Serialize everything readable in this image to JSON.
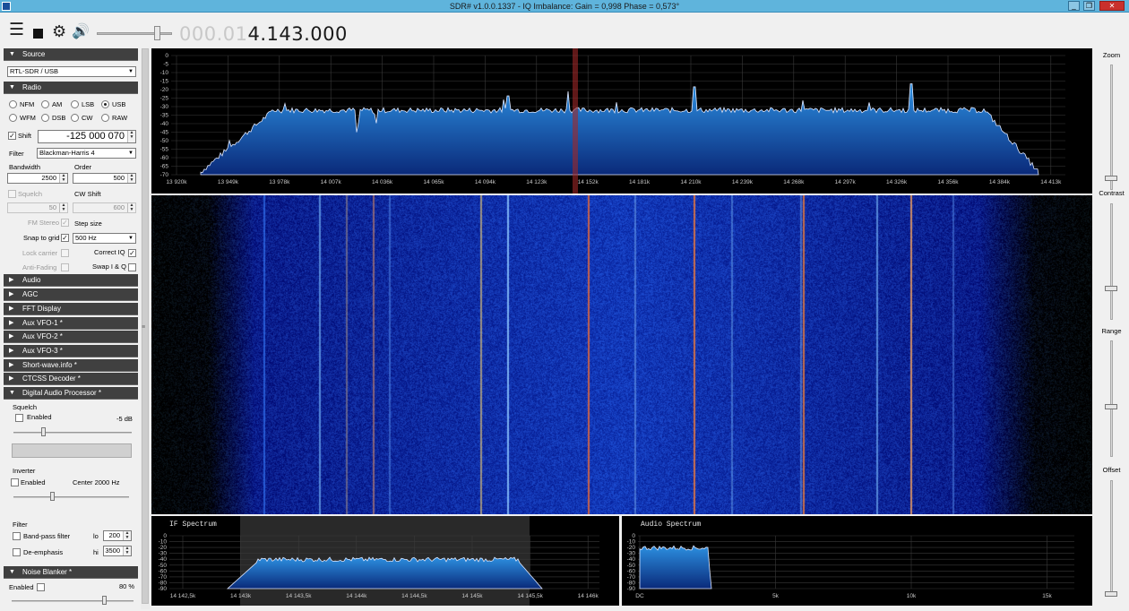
{
  "window": {
    "title": "SDR# v1.0.0.1337 - IQ Imbalance: Gain = 0,998 Phase = 0,573°",
    "controls": {
      "minimize": "_",
      "maximize": "❐",
      "close": "✕"
    }
  },
  "toolbar": {
    "icons": [
      "menu-icon",
      "stop-icon",
      "gear-icon",
      "speaker-icon"
    ],
    "frequency_dim": "000.01",
    "frequency_main": "4.143.000"
  },
  "source": {
    "header": "Source",
    "device": "RTL-SDR / USB"
  },
  "radio": {
    "header": "Radio",
    "modes": [
      "NFM",
      "AM",
      "LSB",
      "USB",
      "WFM",
      "DSB",
      "CW",
      "RAW"
    ],
    "selected_mode": "USB",
    "shift_label": "Shift",
    "shift_value": "-125 000 070",
    "filter_label": "Filter",
    "filter_value": "Blackman-Harris 4",
    "bandwidth_label": "Bandwidth",
    "bandwidth_value": "2500",
    "order_label": "Order",
    "order_value": "500",
    "squelch_label": "Squelch",
    "squelch_value": "50",
    "cwshift_label": "CW Shift",
    "cwshift_value": "600",
    "fmstereo_label": "FM Stereo",
    "stepsize_label": "Step size",
    "snap_label": "Snap to grid",
    "snap_value": "500 Hz",
    "lockcarrier_label": "Lock carrier",
    "correctiq_label": "Correct IQ",
    "antifading_label": "Anti-Fading",
    "swapiq_label": "Swap I & Q"
  },
  "collapsed_sections": [
    "Audio",
    "AGC",
    "FFT Display",
    "Aux VFO-1 *",
    "Aux VFO-2 *",
    "Aux VFO-3 *",
    "Short-wave.info *",
    "CTCSS Decoder *"
  ],
  "dap": {
    "header": "Digital Audio Processor *",
    "squelch_group": "Squelch",
    "squelch_enabled_label": "Enabled",
    "squelch_level": "-5 dB",
    "inverter_group": "Inverter",
    "inverter_enabled_label": "Enabled",
    "inverter_center": "Center  2000 Hz",
    "filter_group": "Filter",
    "bandpass_label": "Band-pass filter",
    "lo_label": "lo",
    "lo_value": "200",
    "deemphasis_label": "De-emphasis",
    "hi_label": "hi",
    "hi_value": "3500"
  },
  "noise_blanker": {
    "header": "Noise Blanker *",
    "enabled_label": "Enabled",
    "percent": "80 %"
  },
  "spectrum": {
    "y_ticks": [
      "0",
      "-5",
      "-10",
      "-15",
      "-20",
      "-25",
      "-30",
      "-35",
      "-40",
      "-45",
      "-50",
      "-55",
      "-60",
      "-65",
      "-70"
    ],
    "x_ticks": [
      "13 920k",
      "13 949k",
      "13 978k",
      "14 007k",
      "14 036k",
      "14 065k",
      "14 094k",
      "14 123k",
      "14 152k",
      "14 181k",
      "14 210k",
      "14 239k",
      "14 268k",
      "14 297k",
      "14 326k",
      "14 356k",
      "14 384k",
      "14 413k"
    ]
  },
  "if_spectrum": {
    "title": "IF Spectrum",
    "y_ticks": [
      "0",
      "-10",
      "-20",
      "-30",
      "-40",
      "-50",
      "-60",
      "-70",
      "-80",
      "-90"
    ],
    "x_ticks": [
      "14 142,5k",
      "14 143k",
      "14 143,5k",
      "14 144k",
      "14 144,5k",
      "14 145k",
      "14 145,5k",
      "14 146k"
    ]
  },
  "audio_spectrum": {
    "title": "Audio Spectrum",
    "y_ticks": [
      "0",
      "-10",
      "-20",
      "-30",
      "-40",
      "-50",
      "-60",
      "-70",
      "-80",
      "-90"
    ],
    "x_ticks": [
      "DC",
      "5k",
      "10k",
      "15k"
    ]
  },
  "rightbar": {
    "zoom_label": "Zoom",
    "contrast_label": "Contrast",
    "range_label": "Range",
    "offset_label": "Offset"
  },
  "colors": {
    "titlebar": "#5fb4dc",
    "section_header": "#404040",
    "spectrum_fill": "#1c5fb0",
    "waterfall_bg": "#0a1a7a",
    "vfo_marker": "#c83232"
  }
}
